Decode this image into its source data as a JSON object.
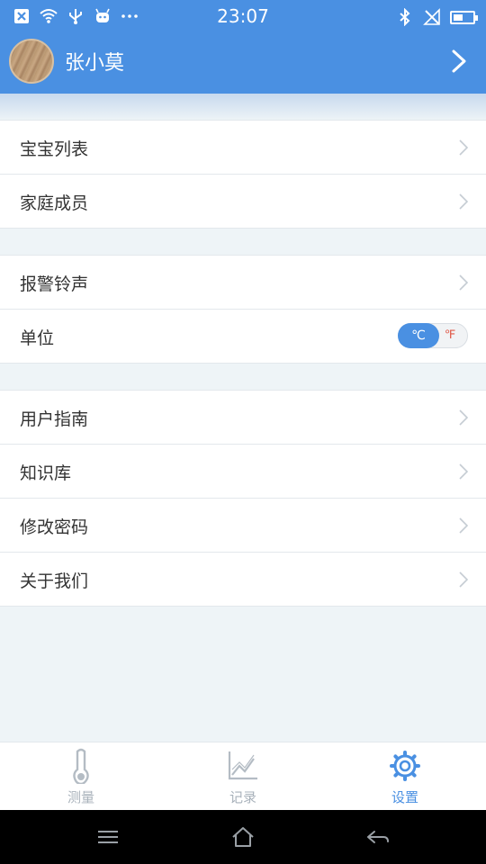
{
  "status_bar": {
    "time": "23:07",
    "left_icons": [
      "close-box-icon",
      "wifi-icon",
      "usb-icon",
      "android-icon",
      "more-dots-icon"
    ],
    "right_icons": [
      "bluetooth-icon",
      "no-signal-icon",
      "battery-icon"
    ]
  },
  "header": {
    "user_name": "张小莫",
    "accent_color": "#4a90e2"
  },
  "groups": [
    {
      "items": [
        {
          "label": "宝宝列表"
        },
        {
          "label": "家庭成员"
        }
      ]
    },
    {
      "items": [
        {
          "label": "报警铃声"
        },
        {
          "label": "单位",
          "toggle": {
            "options": [
              "℃",
              "℉"
            ],
            "selected": "℃"
          }
        }
      ]
    },
    {
      "items": [
        {
          "label": "用户指南"
        },
        {
          "label": "知识库"
        },
        {
          "label": "修改密码"
        },
        {
          "label": "关于我们"
        }
      ]
    }
  ],
  "tabbar": {
    "tabs": [
      {
        "label": "测量",
        "icon": "thermometer-icon",
        "active": false
      },
      {
        "label": "记录",
        "icon": "chart-icon",
        "active": false
      },
      {
        "label": "设置",
        "icon": "gear-icon",
        "active": true
      }
    ]
  }
}
